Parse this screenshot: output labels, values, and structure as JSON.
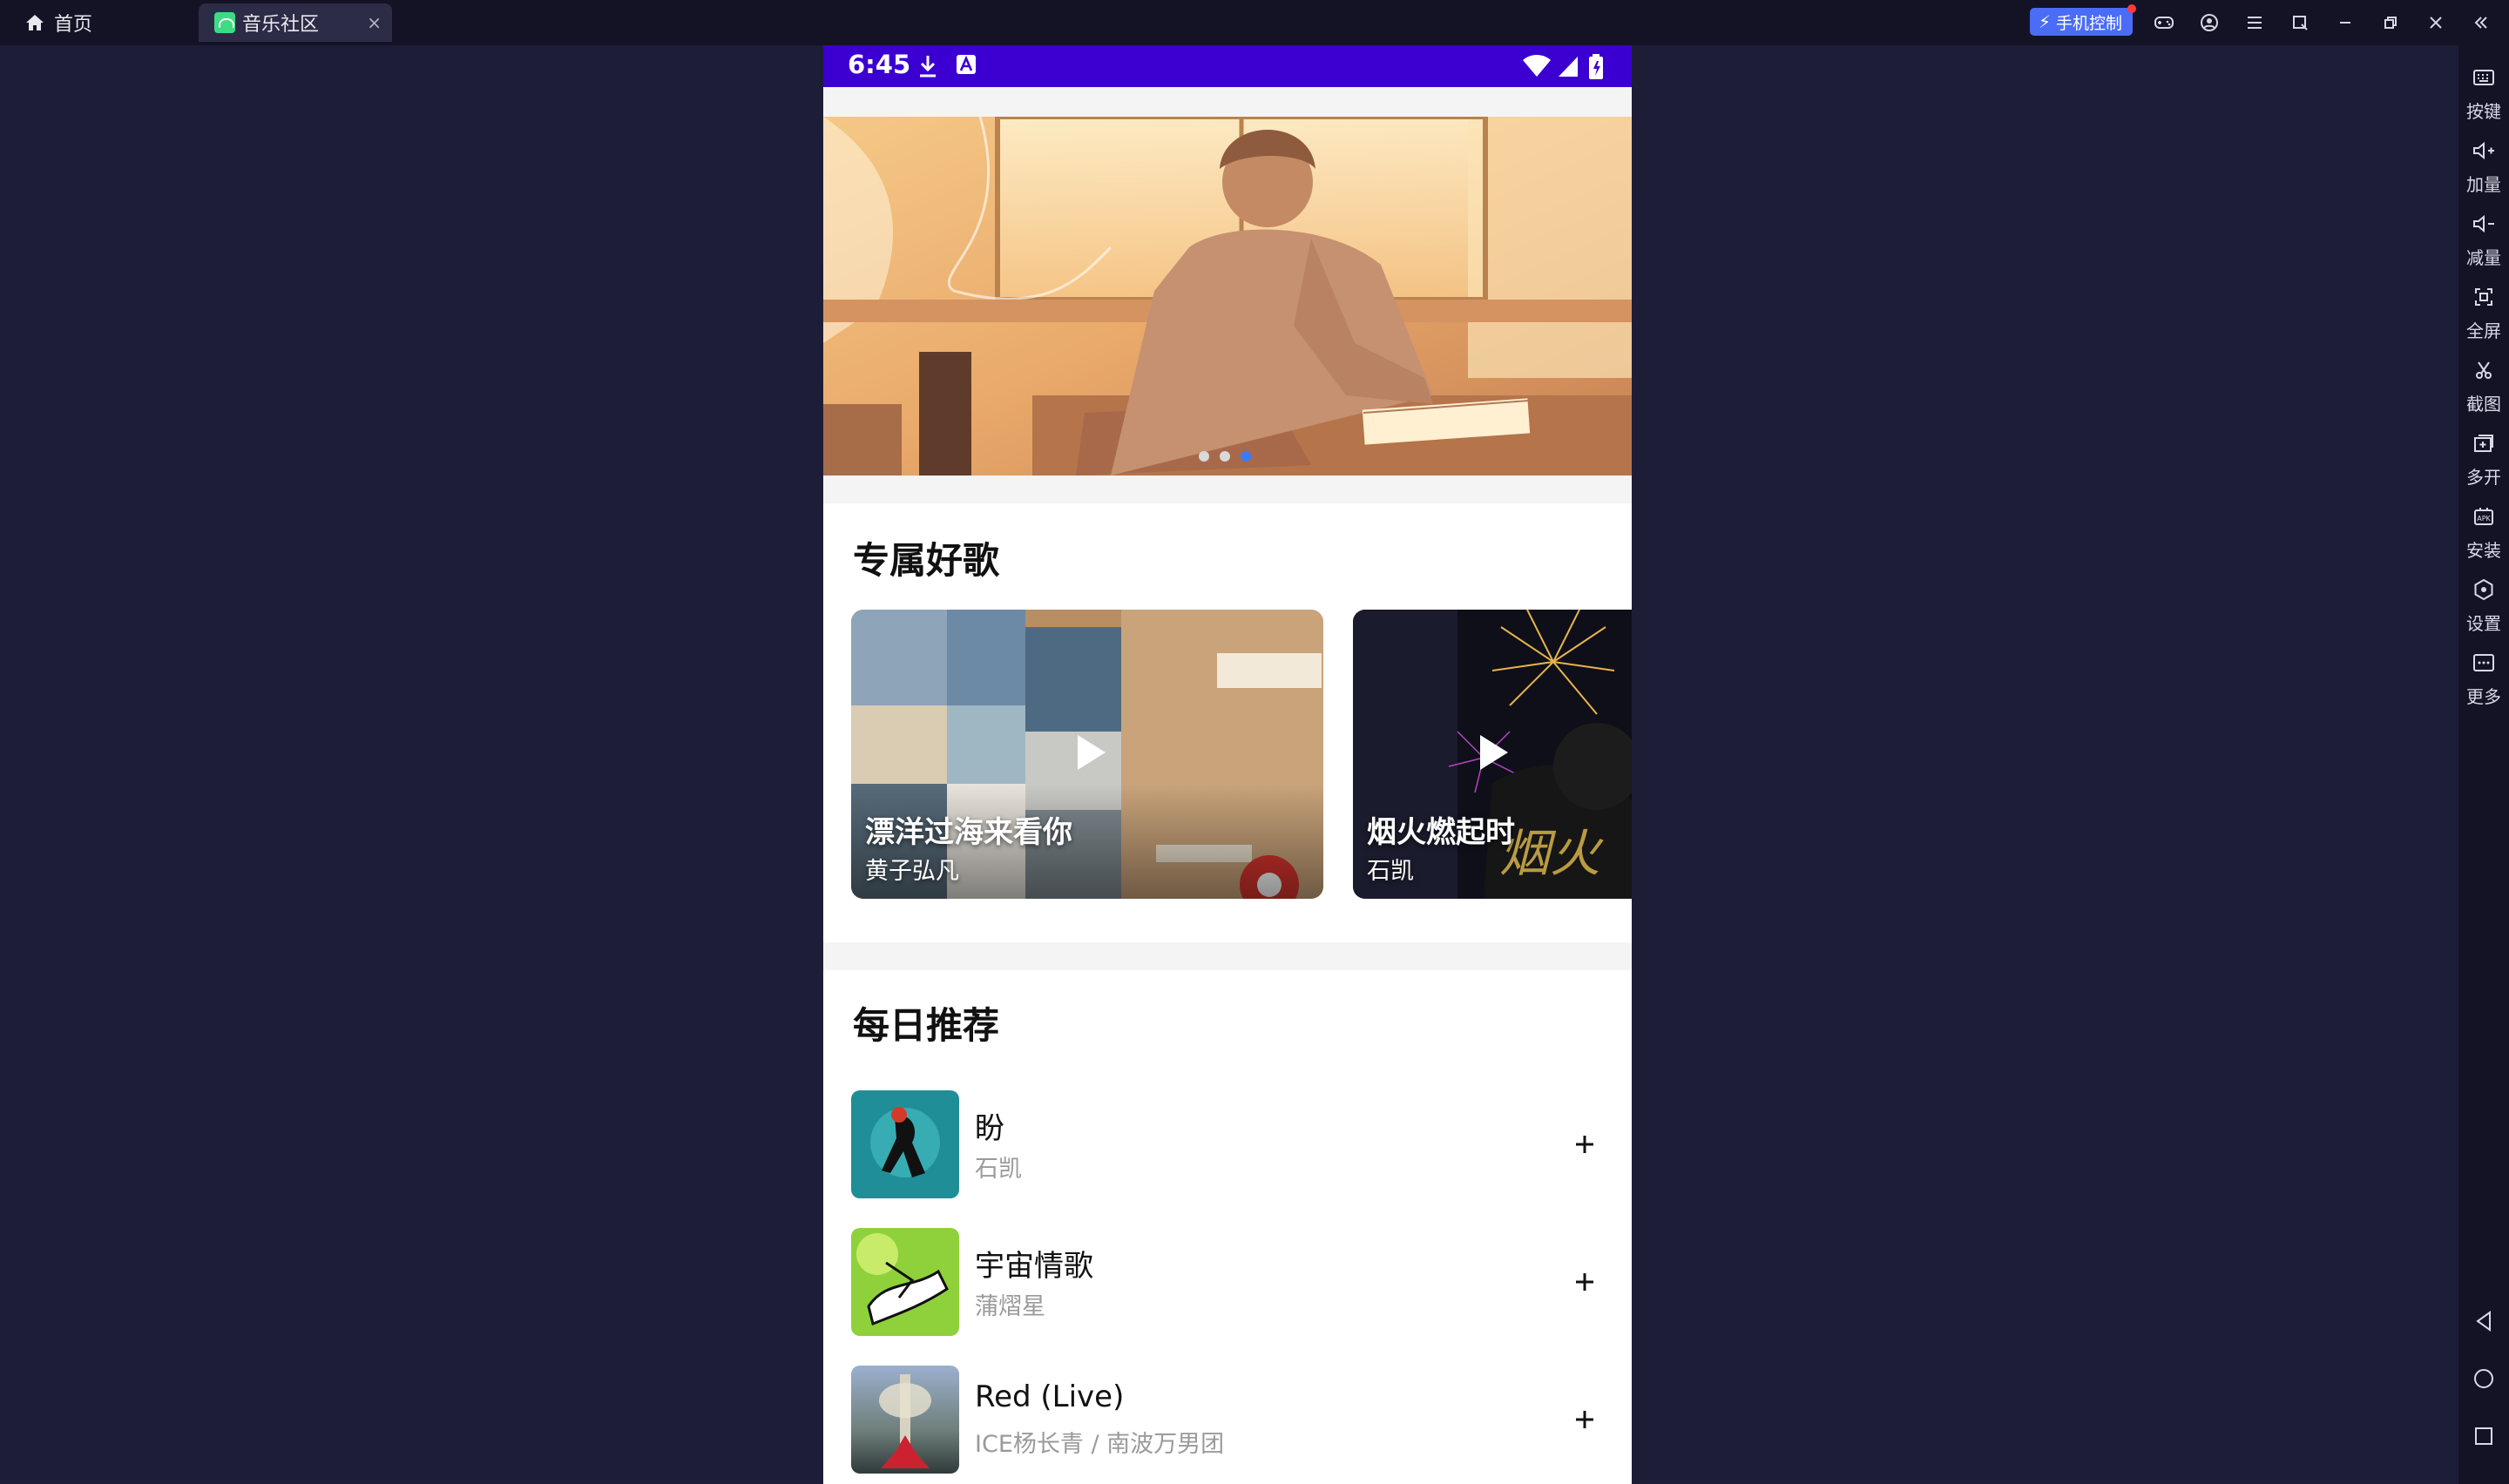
{
  "window": {
    "home_tab": "首页",
    "active_tab": "音乐社区",
    "close_symbol": "×",
    "phone_control": "手机控制"
  },
  "sidebar": {
    "items": [
      {
        "label": "按键",
        "icon": "keyboard-icon"
      },
      {
        "label": "加量",
        "icon": "volume-up-icon"
      },
      {
        "label": "减量",
        "icon": "volume-down-icon"
      },
      {
        "label": "全屏",
        "icon": "fullscreen-icon"
      },
      {
        "label": "截图",
        "icon": "scissors-icon"
      },
      {
        "label": "多开",
        "icon": "multi-instance-icon"
      },
      {
        "label": "安装",
        "icon": "apk-install-icon"
      },
      {
        "label": "设置",
        "icon": "settings-icon"
      },
      {
        "label": "更多",
        "icon": "more-icon"
      }
    ]
  },
  "status_bar": {
    "time": "6:45"
  },
  "banner": {
    "page_count": 3,
    "active_index": 2
  },
  "exclusive": {
    "title": "专属好歌",
    "cards": [
      {
        "title": "漂洋过海来看你",
        "artist": "黄子弘凡"
      },
      {
        "title": "烟火燃起时",
        "artist": "石凯"
      }
    ]
  },
  "daily": {
    "title": "每日推荐",
    "songs": [
      {
        "title": "盼",
        "artist": "石凯"
      },
      {
        "title": "宇宙情歌",
        "artist": "蒲熠星"
      },
      {
        "title": "Red (Live)",
        "artist": "ICE杨长青 / 南波万男团"
      }
    ]
  },
  "colors": {
    "status_bar": "#3b00d1",
    "emulator_bg": "#1e1d38",
    "accent_dot": "#3a7cf5",
    "phone_control": "#4a6cf7"
  }
}
